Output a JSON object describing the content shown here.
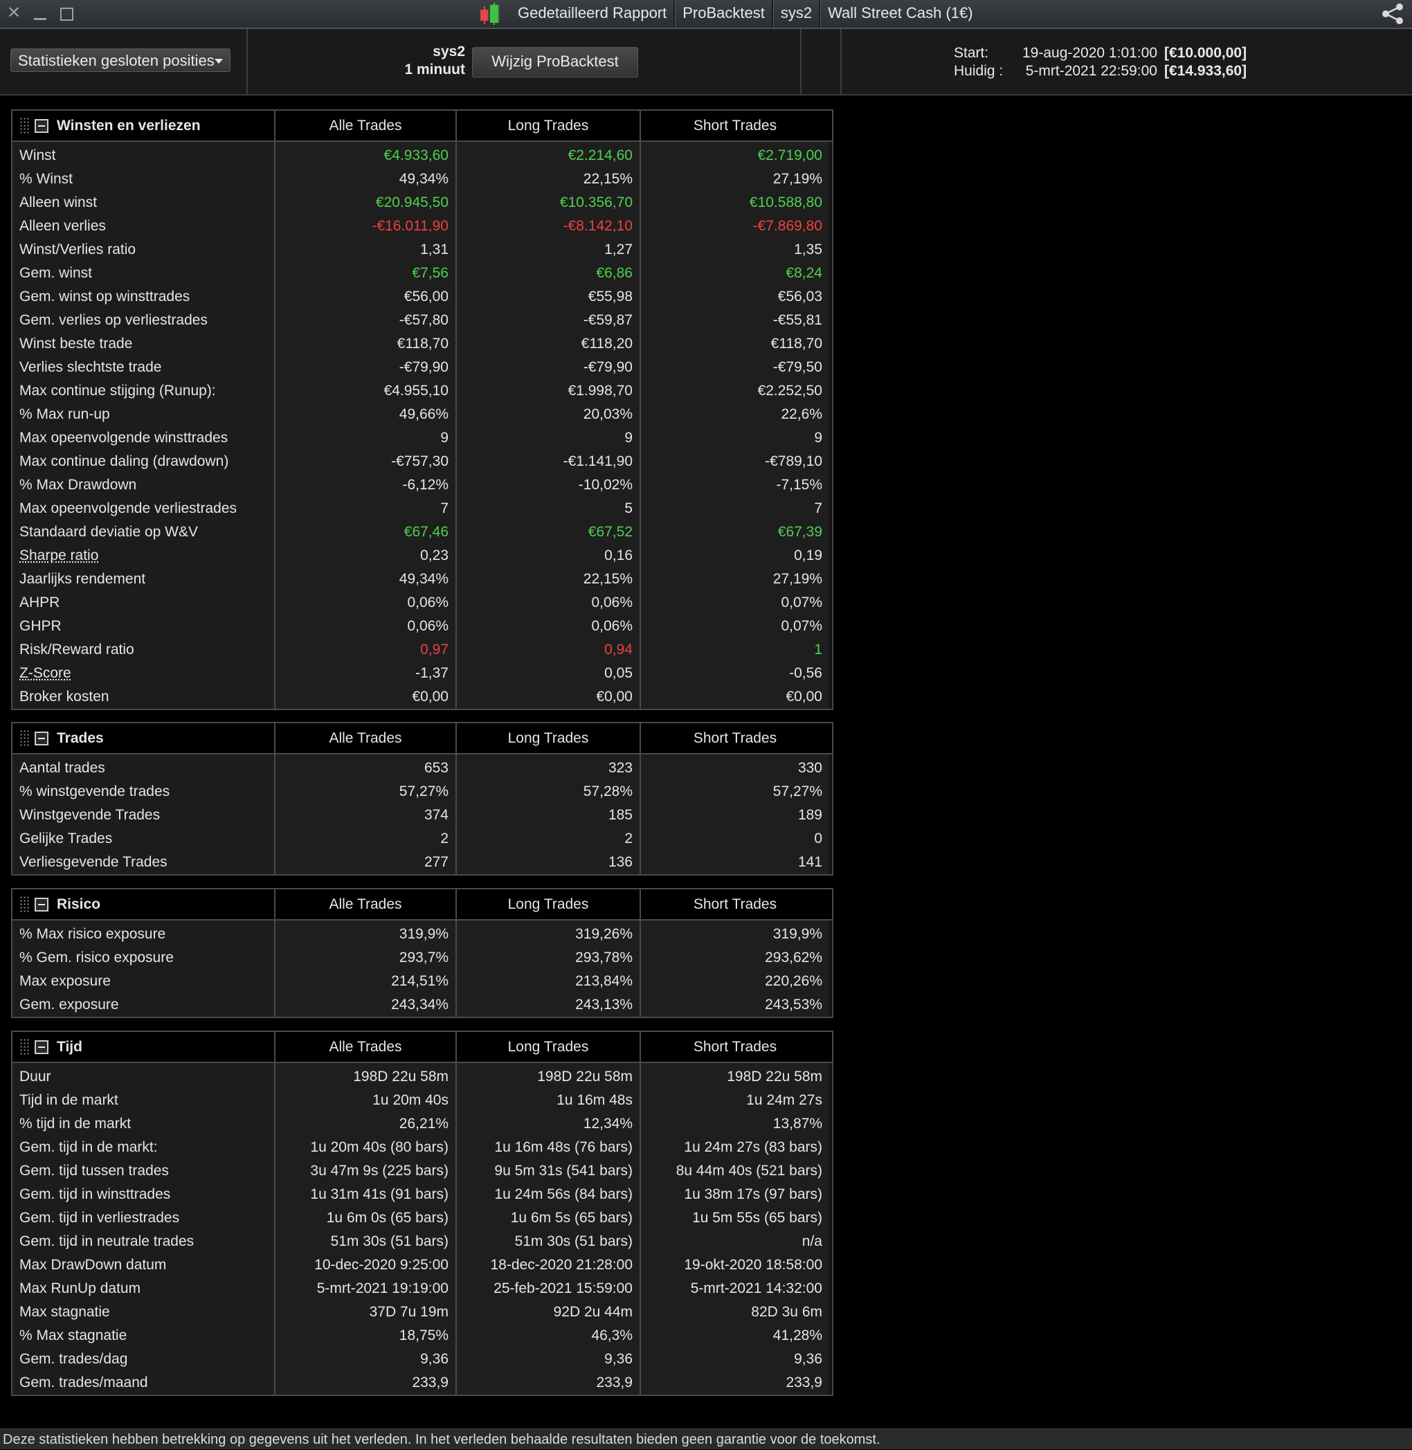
{
  "titlebar": {
    "segments": [
      "Gedetailleerd Rapport",
      "ProBacktest",
      "sys2",
      "Wall Street Cash (1€)"
    ]
  },
  "header": {
    "dropdown_label": "Statistieken gesloten posities",
    "system_name": "sys2",
    "timeframe": "1 minuut",
    "edit_button": "Wijzig ProBacktest",
    "start_label": "Start:",
    "start_date": "19-aug-2020 1:01:00",
    "start_amount": "[€10.000,00]",
    "current_label": "Huidig :",
    "current_date": "5-mrt-2021 22:59:00",
    "current_amount": "[€14.933,60]"
  },
  "columns": [
    "Alle Trades",
    "Long Trades",
    "Short Trades"
  ],
  "colors": {
    "positive": "#4fd14f",
    "negative": "#f04040"
  },
  "panels": [
    {
      "title": "Winsten en verliezen",
      "rows": [
        {
          "label": "Winst",
          "values": [
            "€4.933,60",
            "€2.214,60",
            "€2.719,00"
          ],
          "colors": [
            "green",
            "green",
            "green"
          ]
        },
        {
          "label": "% Winst",
          "values": [
            "49,34%",
            "22,15%",
            "27,19%"
          ]
        },
        {
          "label": "Alleen winst",
          "values": [
            "€20.945,50",
            "€10.356,70",
            "€10.588,80"
          ],
          "colors": [
            "green",
            "green",
            "green"
          ]
        },
        {
          "label": "Alleen verlies",
          "values": [
            "-€16.011,90",
            "-€8.142,10",
            "-€7.869,80"
          ],
          "colors": [
            "red",
            "red",
            "red"
          ]
        },
        {
          "label": "Winst/Verlies ratio",
          "values": [
            "1,31",
            "1,27",
            "1,35"
          ]
        },
        {
          "label": "Gem. winst",
          "values": [
            "€7,56",
            "€6,86",
            "€8,24"
          ],
          "colors": [
            "green",
            "green",
            "green"
          ]
        },
        {
          "label": "Gem. winst op winsttrades",
          "values": [
            "€56,00",
            "€55,98",
            "€56,03"
          ]
        },
        {
          "label": "Gem. verlies op verliestrades",
          "values": [
            "-€57,80",
            "-€59,87",
            "-€55,81"
          ]
        },
        {
          "label": "Winst beste trade",
          "values": [
            "€118,70",
            "€118,20",
            "€118,70"
          ]
        },
        {
          "label": "Verlies slechtste trade",
          "values": [
            "-€79,90",
            "-€79,90",
            "-€79,50"
          ]
        },
        {
          "label": "Max continue stijging (Runup):",
          "values": [
            "€4.955,10",
            "€1.998,70",
            "€2.252,50"
          ]
        },
        {
          "label": "% Max run-up",
          "values": [
            "49,66%",
            "20,03%",
            "22,6%"
          ]
        },
        {
          "label": "Max opeenvolgende winsttrades",
          "values": [
            "9",
            "9",
            "9"
          ]
        },
        {
          "label": "Max continue daling (drawdown)",
          "values": [
            "-€757,30",
            "-€1.141,90",
            "-€789,10"
          ]
        },
        {
          "label": "% Max Drawdown",
          "values": [
            "-6,12%",
            "-10,02%",
            "-7,15%"
          ]
        },
        {
          "label": "Max opeenvolgende verliestrades",
          "values": [
            "7",
            "5",
            "7"
          ]
        },
        {
          "label": "Standaard deviatie op W&V",
          "values": [
            "€67,46",
            "€67,52",
            "€67,39"
          ],
          "colors": [
            "green",
            "green",
            "green"
          ]
        },
        {
          "label": "Sharpe ratio",
          "underline": true,
          "values": [
            "0,23",
            "0,16",
            "0,19"
          ]
        },
        {
          "label": "Jaarlijks rendement",
          "values": [
            "49,34%",
            "22,15%",
            "27,19%"
          ]
        },
        {
          "label": "AHPR",
          "values": [
            "0,06%",
            "0,06%",
            "0,07%"
          ]
        },
        {
          "label": "GHPR",
          "values": [
            "0,06%",
            "0,06%",
            "0,07%"
          ]
        },
        {
          "label": "Risk/Reward ratio",
          "values": [
            "0,97",
            "0,94",
            "1"
          ],
          "colors": [
            "red",
            "red",
            "green"
          ]
        },
        {
          "label": "Z-Score",
          "underline": true,
          "values": [
            "-1,37",
            "0,05",
            "-0,56"
          ]
        },
        {
          "label": "Broker kosten",
          "values": [
            "€0,00",
            "€0,00",
            "€0,00"
          ]
        }
      ]
    },
    {
      "title": "Trades",
      "rows": [
        {
          "label": "Aantal trades",
          "values": [
            "653",
            "323",
            "330"
          ]
        },
        {
          "label": "% winstgevende trades",
          "values": [
            "57,27%",
            "57,28%",
            "57,27%"
          ]
        },
        {
          "label": "Winstgevende Trades",
          "values": [
            "374",
            "185",
            "189"
          ]
        },
        {
          "label": "Gelijke Trades",
          "values": [
            "2",
            "2",
            "0"
          ]
        },
        {
          "label": "Verliesgevende Trades",
          "values": [
            "277",
            "136",
            "141"
          ]
        }
      ]
    },
    {
      "title": "Risico",
      "rows": [
        {
          "label": "% Max risico exposure",
          "values": [
            "319,9%",
            "319,26%",
            "319,9%"
          ]
        },
        {
          "label": "% Gem. risico exposure",
          "values": [
            "293,7%",
            "293,78%",
            "293,62%"
          ]
        },
        {
          "label": "Max exposure",
          "values": [
            "214,51%",
            "213,84%",
            "220,26%"
          ]
        },
        {
          "label": "Gem. exposure",
          "values": [
            "243,34%",
            "243,13%",
            "243,53%"
          ]
        }
      ]
    },
    {
      "title": "Tijd",
      "rows": [
        {
          "label": "Duur",
          "values": [
            "198D 22u 58m",
            "198D 22u 58m",
            "198D 22u 58m"
          ]
        },
        {
          "label": "Tijd in de markt",
          "values": [
            "1u 20m 40s",
            "1u 16m 48s",
            "1u 24m 27s"
          ]
        },
        {
          "label": "% tijd in de markt",
          "values": [
            "26,21%",
            "12,34%",
            "13,87%"
          ]
        },
        {
          "label": "Gem. tijd in de markt:",
          "values": [
            "1u 20m 40s (80 bars)",
            "1u 16m 48s (76 bars)",
            "1u 24m 27s (83 bars)"
          ]
        },
        {
          "label": "Gem. tijd tussen trades",
          "values": [
            "3u 47m 9s (225 bars)",
            "9u 5m 31s (541 bars)",
            "8u 44m 40s (521 bars)"
          ]
        },
        {
          "label": "Gem. tijd in winsttrades",
          "values": [
            "1u 31m 41s (91 bars)",
            "1u 24m 56s (84 bars)",
            "1u 38m 17s (97 bars)"
          ]
        },
        {
          "label": "Gem. tijd in verliestrades",
          "values": [
            "1u 6m 0s (65 bars)",
            "1u 6m 5s (65 bars)",
            "1u 5m 55s (65 bars)"
          ]
        },
        {
          "label": "Gem. tijd in neutrale trades",
          "values": [
            "51m 30s (51 bars)",
            "51m 30s (51 bars)",
            "n/a"
          ]
        },
        {
          "label": "Max DrawDown datum",
          "values": [
            "10-dec-2020 9:25:00",
            "18-dec-2020 21:28:00",
            "19-okt-2020 18:58:00"
          ]
        },
        {
          "label": "Max RunUp datum",
          "values": [
            "5-mrt-2021 19:19:00",
            "25-feb-2021 15:59:00",
            "5-mrt-2021 14:32:00"
          ]
        },
        {
          "label": "Max stagnatie",
          "values": [
            "37D 7u 19m",
            "92D 2u 44m",
            "82D 3u 6m"
          ]
        },
        {
          "label": "% Max stagnatie",
          "values": [
            "18,75%",
            "46,3%",
            "41,28%"
          ]
        },
        {
          "label": "Gem. trades/dag",
          "values": [
            "9,36",
            "9,36",
            "9,36"
          ]
        },
        {
          "label": "Gem. trades/maand",
          "values": [
            "233,9",
            "233,9",
            "233,9"
          ]
        }
      ]
    }
  ],
  "footer": "Deze statistieken hebben betrekking op gegevens uit het verleden. In het verleden behaalde resultaten bieden geen garantie voor de toekomst."
}
